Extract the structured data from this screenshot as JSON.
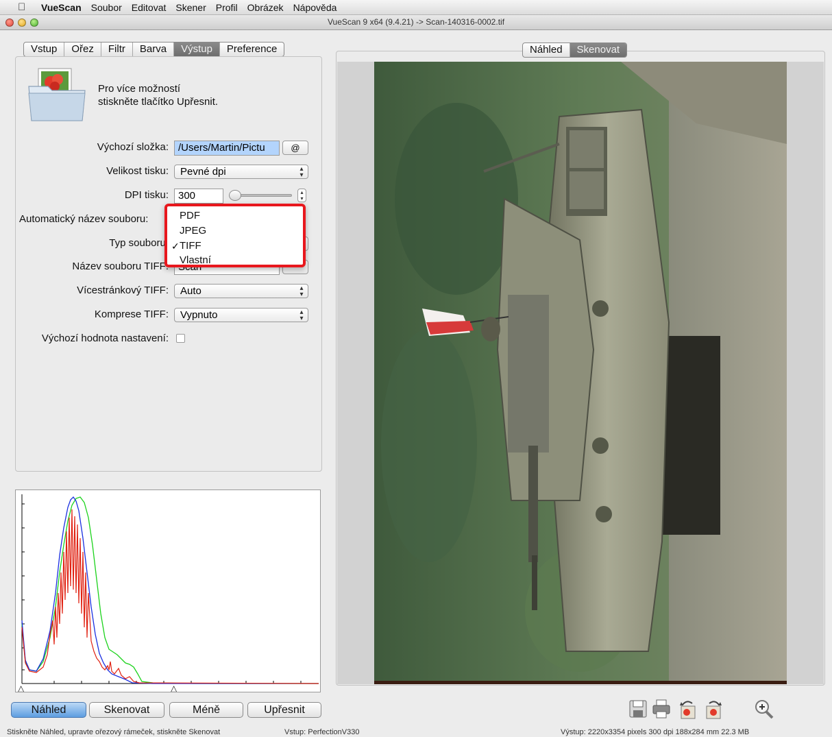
{
  "menubar": {
    "apple_icon": "apple-logo-icon",
    "items": [
      "VueScan",
      "Soubor",
      "Editovat",
      "Skener",
      "Profil",
      "Obrázek",
      "Nápověda"
    ]
  },
  "window": {
    "title": "VueScan 9 x64 (9.4.21) -> Scan-140316-0002.tif"
  },
  "left_tabs": [
    {
      "label": "Vstup",
      "active": false
    },
    {
      "label": "Ořez",
      "active": false
    },
    {
      "label": "Filtr",
      "active": false
    },
    {
      "label": "Barva",
      "active": false
    },
    {
      "label": "Výstup",
      "active": true
    },
    {
      "label": "Preference",
      "active": false
    }
  ],
  "right_tabs": [
    {
      "label": "Náhled",
      "active": false
    },
    {
      "label": "Skenovat",
      "active": true
    }
  ],
  "hint": {
    "line1": "Pro více možností",
    "line2": "stiskněte tlačítko Upřesnit."
  },
  "form": {
    "default_folder_label": "Výchozí složka:",
    "default_folder_value": "/Users/Martin/Pictu",
    "folder_button": "@",
    "print_size_label": "Velikost tisku:",
    "print_size_value": "Pevné dpi",
    "print_dpi_label": "DPI tisku:",
    "print_dpi_value": "300",
    "auto_filename_label": "Automatický název souboru:",
    "file_type_label": "Typ souboru:",
    "tiff_filename_label": "Název souboru TIFF:",
    "tiff_filename_value": "Scan",
    "multipage_label": "Vícestránkový TIFF:",
    "multipage_value": "Auto",
    "compression_label": "Komprese TIFF:",
    "compression_value": "Vypnuto",
    "defaults_label": "Výchozí hodnota nastavení:"
  },
  "file_type_menu": {
    "options": [
      "PDF",
      "JPEG",
      "TIFF",
      "Vlastní"
    ],
    "selected": "TIFF",
    "check_mark": "✓",
    "highlight_color": "#e8171d"
  },
  "histogram": {
    "markers": [
      "△",
      "△"
    ],
    "series_colors": {
      "red": "#e02010",
      "green": "#1bd21b",
      "blue": "#1a2fe0"
    }
  },
  "bottom_buttons": {
    "preview": "Náhled",
    "scan": "Skenovat",
    "less": "Méně",
    "more": "Upřesnit"
  },
  "toolbar_icons": [
    "save-icon",
    "print-icon",
    "rotate-left-icon",
    "rotate-right-icon",
    "zoom-icon"
  ],
  "status": {
    "left": "Stiskněte Náhled, upravte ořezový rámeček, stiskněte Skenovat",
    "middle": "Vstup: PerfectionV330",
    "right": "Výstup: 2220x3354 pixels 300 dpi 188x284 mm 22.3 MB"
  }
}
